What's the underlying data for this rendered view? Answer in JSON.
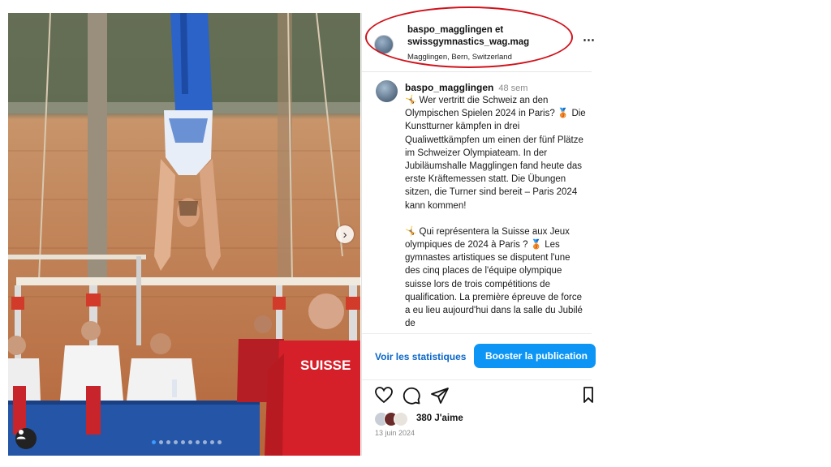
{
  "header": {
    "username_line1": "baspo_magglingen et",
    "username_line2": "swissgymnastics_wag.mag",
    "location": "Magglingen, Bern, Switzerland"
  },
  "caption": {
    "username": "baspo_magglingen",
    "time_ago": "48 sem",
    "paragraph_de": "🤸 Wer vertritt die Schweiz an den Olympischen Spielen 2024 in Paris? 🥉 Die Kunstturner kämpfen in drei Qualiwettkämpfen um einen der fünf Plätze im Schweizer Olympiateam. In der Jubiläumshalle Magglingen fand heute das erste Kräftemessen statt. Die Übungen sitzen, die Turner sind bereit – Paris 2024 kann kommen!",
    "paragraph_fr": "🤸 Qui représentera la Suisse aux Jeux olympiques de 2024 à Paris ? 🥉 Les gymnastes artistiques se disputent l'une des cinq places de l'équipe olympique suisse lors de trois compétitions de qualification. La première épreuve de force a eu lieu aujourd'hui dans la salle du Jubilé de"
  },
  "actions": {
    "stats_label": "Voir les statistiques",
    "boost_label": "Booster la publication"
  },
  "likes": {
    "text": "380 J'aime"
  },
  "date": "13 juin 2024",
  "photo": {
    "jersey_text": "SUISSE",
    "carousel_total": 10,
    "carousel_active": 0
  },
  "colors": {
    "accent_blue": "#0d95f5",
    "link_blue": "#0a66c8",
    "annotation_red": "#d0121b"
  },
  "icons": [
    "more-options-icon",
    "heart-icon",
    "comment-icon",
    "share-icon",
    "bookmark-icon",
    "chevron-right-icon",
    "user-tag-icon"
  ]
}
